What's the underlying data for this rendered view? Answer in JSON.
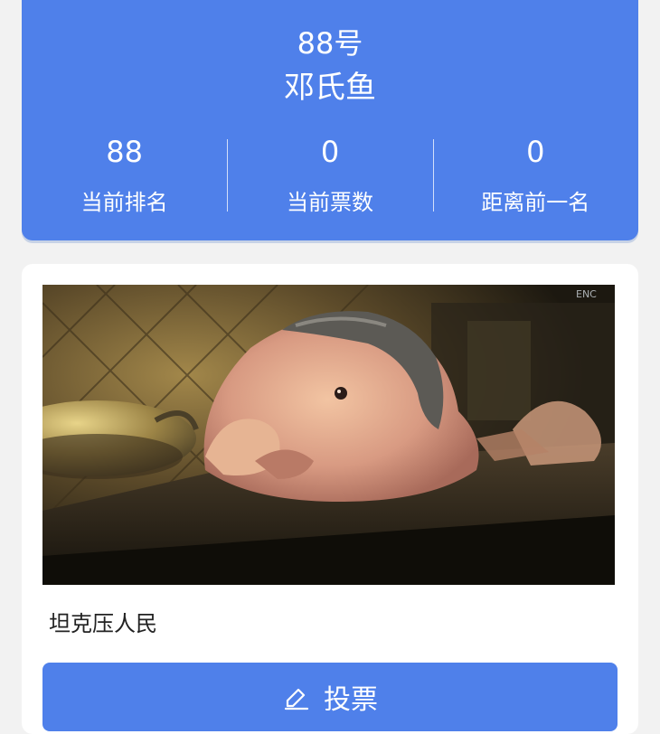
{
  "header": {
    "number": "88号",
    "name": "邓氏鱼",
    "stats": [
      {
        "value": "88",
        "label": "当前排名"
      },
      {
        "value": "0",
        "label": "当前票数"
      },
      {
        "value": "0",
        "label": "距离前一名"
      }
    ]
  },
  "entry": {
    "description": "坦克压人民",
    "watermark": "ENC"
  },
  "vote_button": {
    "label": "投票",
    "icon": "edit-icon"
  },
  "colors": {
    "primary": "#4f80ea",
    "page_background": "#f2f2f2",
    "card_background": "#ffffff"
  }
}
